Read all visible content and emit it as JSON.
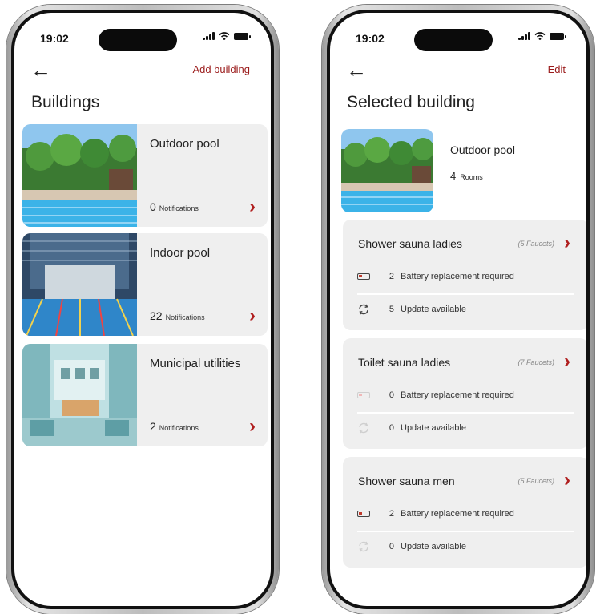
{
  "left_phone": {
    "time": "19:02",
    "top_action": "Add building",
    "title": "Buildings",
    "buildings": [
      {
        "name": "Outdoor pool",
        "count": "0",
        "count_label": "Notifications"
      },
      {
        "name": "Indoor pool",
        "count": "22",
        "count_label": "Notifications"
      },
      {
        "name": "Municipal utilities",
        "count": "2",
        "count_label": "Notifications"
      }
    ]
  },
  "right_phone": {
    "time": "19:02",
    "top_action": "Edit",
    "title": "Selected building",
    "building_name": "Outdoor pool",
    "rooms_count": "4",
    "rooms_label": "Rooms",
    "rooms": [
      {
        "name": "Shower sauna ladies",
        "faucets": "(5 Faucets)",
        "battery_count": "2",
        "battery_label": "Battery replacement required",
        "update_count": "5",
        "update_label": "Update available"
      },
      {
        "name": "Toilet sauna ladies",
        "faucets": "(7 Faucets)",
        "battery_count": "0",
        "battery_label": "Battery replacement required",
        "update_count": "0",
        "update_label": "Update available"
      },
      {
        "name": "Shower sauna men",
        "faucets": "(5 Faucets)",
        "battery_count": "2",
        "battery_label": "Battery replacement required",
        "update_count": "0",
        "update_label": "Update available"
      }
    ]
  },
  "icons": {
    "back": "arrow-left-icon",
    "chevron": "chevron-right-icon",
    "battery_alert": "battery-low-icon",
    "update": "refresh-icon"
  },
  "colors": {
    "accent": "#b01e1e",
    "card_bg": "#efefef",
    "text": "#222222"
  }
}
